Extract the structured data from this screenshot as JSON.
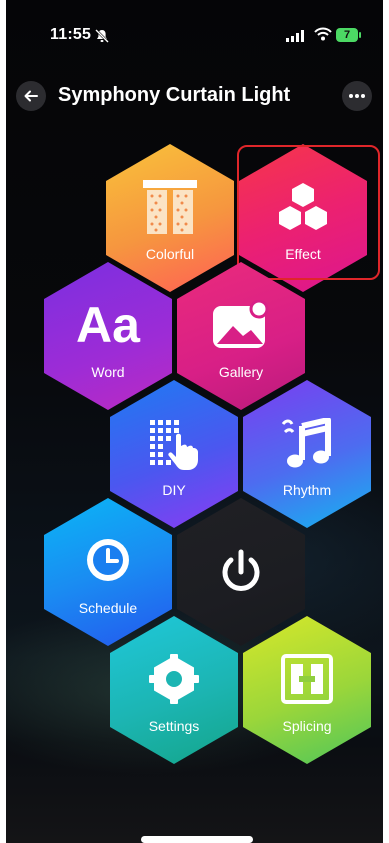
{
  "status_bar": {
    "time": "11:55",
    "battery": "7"
  },
  "header": {
    "title": "Symphony Curtain Light"
  },
  "menu": {
    "colorful": "Colorful",
    "effect": "Effect",
    "word": "Word",
    "word_glyph": "Aa",
    "gallery": "Gallery",
    "diy": "DIY",
    "rhythm": "Rhythm",
    "schedule": "Schedule",
    "settings": "Settings",
    "splicing": "Splicing"
  },
  "colors": {
    "highlight": "#e0262a",
    "colorful": [
      "#f7b23b",
      "#ff6f4e"
    ],
    "effect": [
      "#f5314d",
      "#e2188d"
    ],
    "word": [
      "#8d2de0",
      "#b42bc8"
    ],
    "gallery": [
      "#e0238a",
      "#c21d7b"
    ],
    "diy": [
      "#2f6cf0",
      "#7e3ff2"
    ],
    "rhythm": [
      "#6a4df0",
      "#1fa8f0"
    ],
    "schedule": [
      "#0aa0f5",
      "#1e4ff0"
    ],
    "settings": [
      "#22c6d0",
      "#17a98f"
    ],
    "splicing": [
      "#b4dd2a",
      "#5fc94c"
    ]
  },
  "icons": [
    "back-arrow-icon",
    "more-dots-icon",
    "curtain-icon",
    "hexagon-cluster-icon",
    "picture-icon",
    "tap-grid-icon",
    "music-note-icon",
    "clock-icon",
    "gear-icon",
    "power-icon",
    "splice-icon"
  ]
}
